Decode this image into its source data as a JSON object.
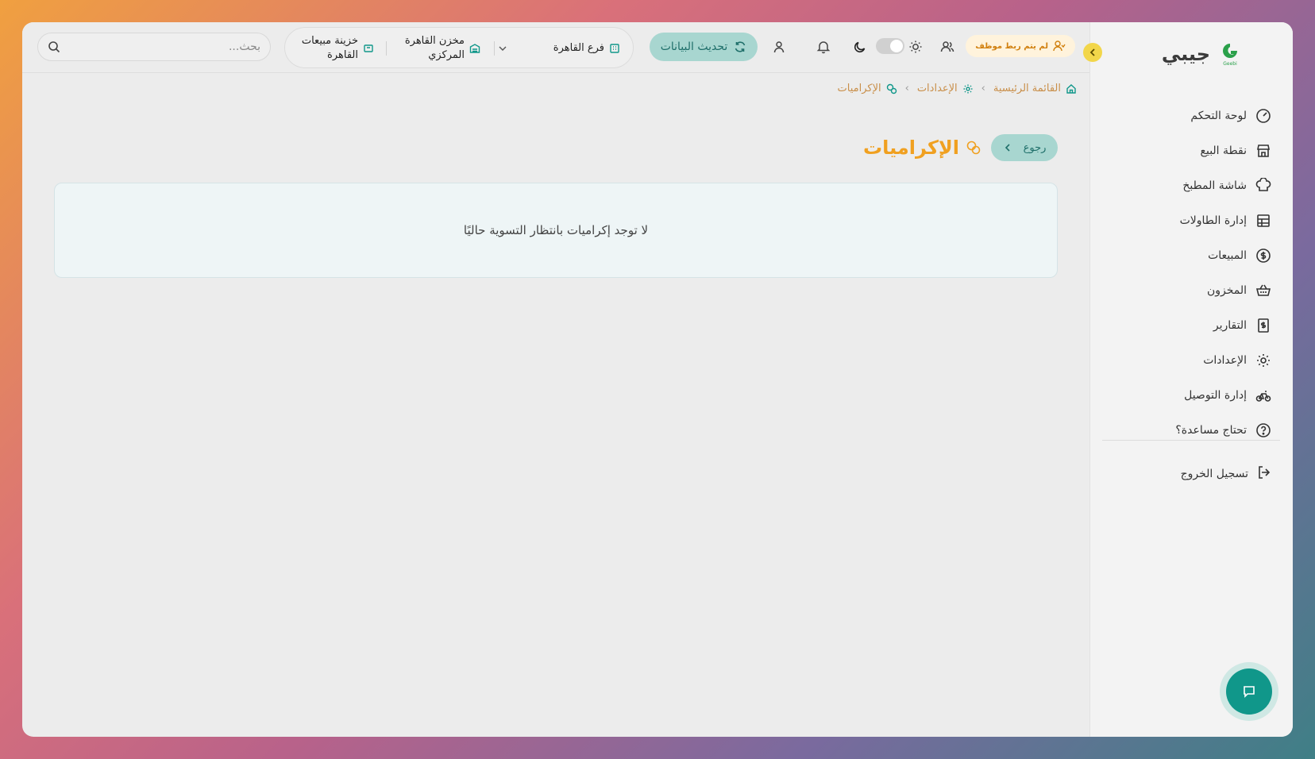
{
  "app": {
    "brand_name": "جيبي",
    "logo_text": "Geebi"
  },
  "sidebar": {
    "items": [
      {
        "label": "لوحة التحكم",
        "icon": "gauge-icon"
      },
      {
        "label": "نقطة البيع",
        "icon": "store-icon"
      },
      {
        "label": "شاشة المطبخ",
        "icon": "chef-hat-icon"
      },
      {
        "label": "إدارة الطاولات",
        "icon": "table-grid-icon"
      },
      {
        "label": "المبيعات",
        "icon": "dollar-circle-icon"
      },
      {
        "label": "المخزون",
        "icon": "basket-icon"
      },
      {
        "label": "التقارير",
        "icon": "report-icon"
      },
      {
        "label": "الإعدادات",
        "icon": "gear-icon"
      },
      {
        "label": "إدارة التوصيل",
        "icon": "bike-icon"
      },
      {
        "label": "تحتاج مساعدة؟",
        "icon": "help-icon"
      }
    ],
    "logout_label": "تسجيل الخروج"
  },
  "topbar": {
    "staff_badge": "لم يتم ربط موظف",
    "refresh_label": "تحديث البيانات",
    "branch": "فرع القاهرة",
    "warehouse": [
      "مخزن القاهرة",
      "المركزي"
    ],
    "treasury": [
      "خزينة مبيعات",
      "القاهرة"
    ],
    "search_placeholder": "بحث..."
  },
  "breadcrumb": {
    "home": "القائمة الرئيسية",
    "settings": "الإعدادات",
    "current": "الإكراميات"
  },
  "page": {
    "back_label": "رجوع",
    "title": "الإكراميات",
    "empty_message": "لا توجد إكراميات بانتظار التسوية حاليًا"
  },
  "colors": {
    "accent_teal": "#10978a",
    "accent_orange": "#f0a020",
    "button_teal_bg": "#a8d6d0"
  }
}
